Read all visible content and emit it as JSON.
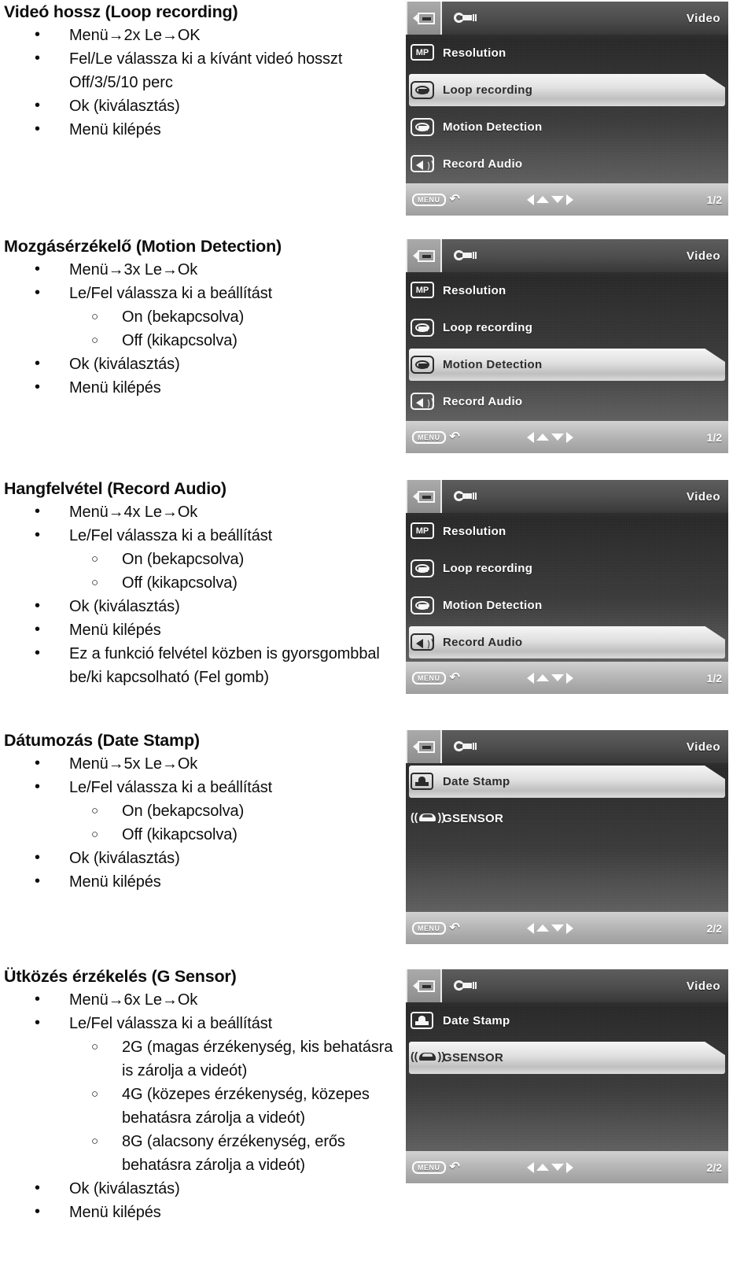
{
  "document": {
    "language": "hu",
    "sections": [
      {
        "id": "loop-recording",
        "heading": "Videó hossz (Loop recording)",
        "items": [
          {
            "level": 1,
            "text": "Menü→2x Le→OK"
          },
          {
            "level": 1,
            "text": "Fel/Le válassza ki a kívánt videó hosszt"
          },
          {
            "level": 0,
            "text": "Off/3/5/10 perc"
          },
          {
            "level": 1,
            "text": "Ok (kiválasztás)"
          },
          {
            "level": 1,
            "text": "Menü kilépés"
          }
        ]
      },
      {
        "id": "motion-detection",
        "heading": "Mozgásérzékelő (Motion Detection)",
        "items": [
          {
            "level": 1,
            "text": "Menü→3x Le→Ok"
          },
          {
            "level": 1,
            "text": "Le/Fel válassza ki a beállítást"
          },
          {
            "level": 2,
            "text": "On (bekapcsolva)"
          },
          {
            "level": 2,
            "text": "Off (kikapcsolva)"
          },
          {
            "level": 1,
            "text": "Ok (kiválasztás)"
          },
          {
            "level": 1,
            "text": "Menü kilépés"
          }
        ]
      },
      {
        "id": "record-audio",
        "heading": "Hangfelvétel (Record Audio)",
        "items": [
          {
            "level": 1,
            "text": "Menü→4x Le→Ok"
          },
          {
            "level": 1,
            "text": "Le/Fel válassza ki a beállítást"
          },
          {
            "level": 2,
            "text": "On (bekapcsolva)"
          },
          {
            "level": 2,
            "text": "Off (kikapcsolva)"
          },
          {
            "level": 1,
            "text": "Ok (kiválasztás)"
          },
          {
            "level": 1,
            "text": "Menü kilépés"
          },
          {
            "level": 1,
            "text": "Ez a funkció felvétel közben is gyorsgombbal be/ki kapcsolható (Fel gomb)"
          }
        ]
      },
      {
        "id": "date-stamp",
        "heading": "Dátumozás (Date Stamp)",
        "items": [
          {
            "level": 1,
            "text": "Menü→5x Le→Ok"
          },
          {
            "level": 1,
            "text": "Le/Fel válassza ki a beállítást"
          },
          {
            "level": 2,
            "text": "On (bekapcsolva)"
          },
          {
            "level": 2,
            "text": "Off (kikapcsolva)"
          },
          {
            "level": 1,
            "text": "Ok (kiválasztás)"
          },
          {
            "level": 1,
            "text": "Menü kilépés"
          }
        ]
      },
      {
        "id": "g-sensor",
        "heading": "Ütközés érzékelés (G Sensor)",
        "items": [
          {
            "level": 1,
            "text": "Menü→6x Le→Ok"
          },
          {
            "level": 1,
            "text": "Le/Fel válassza ki a beállítást"
          },
          {
            "level": 2,
            "text": "2G (magas érzékenység, kis behatásra is zárolja a videót)"
          },
          {
            "level": 2,
            "text": "4G (közepes érzékenység, közepes behatásra zárolja a videót)"
          },
          {
            "level": 2,
            "text": "8G (alacsony érzékenység, erős behatásra zárolja a videót)"
          },
          {
            "level": 1,
            "text": "Ok (kiválasztás)"
          },
          {
            "level": 1,
            "text": "Menü kilépés"
          }
        ]
      }
    ]
  },
  "screenshots": [
    {
      "id": "shot-loop-recording",
      "title": "Video",
      "tabs": [
        "video-camera-icon",
        "wrench-icon"
      ],
      "selected_tab": "video-camera-icon",
      "page_indicator": "1/2",
      "menu_button_label": "MENU",
      "rows": [
        {
          "icon": "mp-icon",
          "icon_text": "MP",
          "label": "Resolution",
          "selected": false
        },
        {
          "icon": "loop-icon",
          "icon_text": "",
          "label": "Loop recording",
          "selected": true
        },
        {
          "icon": "loop-icon",
          "icon_text": "",
          "label": "Motion Detection",
          "selected": false
        },
        {
          "icon": "audio-icon",
          "icon_text": "",
          "label": "Record Audio",
          "selected": false
        }
      ]
    },
    {
      "id": "shot-motion-detection",
      "title": "Video",
      "tabs": [
        "video-camera-icon",
        "wrench-icon"
      ],
      "selected_tab": "video-camera-icon",
      "page_indicator": "1/2",
      "menu_button_label": "MENU",
      "rows": [
        {
          "icon": "mp-icon",
          "icon_text": "MP",
          "label": "Resolution",
          "selected": false
        },
        {
          "icon": "loop-icon",
          "icon_text": "",
          "label": "Loop recording",
          "selected": false
        },
        {
          "icon": "loop-icon",
          "icon_text": "",
          "label": "Motion Detection",
          "selected": true
        },
        {
          "icon": "audio-icon",
          "icon_text": "",
          "label": "Record Audio",
          "selected": false
        }
      ]
    },
    {
      "id": "shot-record-audio",
      "title": "Video",
      "tabs": [
        "video-camera-icon",
        "wrench-icon"
      ],
      "selected_tab": "video-camera-icon",
      "page_indicator": "1/2",
      "menu_button_label": "MENU",
      "rows": [
        {
          "icon": "mp-icon",
          "icon_text": "MP",
          "label": "Resolution",
          "selected": false
        },
        {
          "icon": "loop-icon",
          "icon_text": "",
          "label": "Loop recording",
          "selected": false
        },
        {
          "icon": "loop-icon",
          "icon_text": "",
          "label": "Motion Detection",
          "selected": false
        },
        {
          "icon": "audio-icon",
          "icon_text": "",
          "label": "Record Audio",
          "selected": true
        }
      ]
    },
    {
      "id": "shot-date-stamp",
      "title": "Video",
      "tabs": [
        "video-camera-icon",
        "wrench-icon"
      ],
      "selected_tab": "video-camera-icon",
      "page_indicator": "2/2",
      "menu_button_label": "MENU",
      "rows": [
        {
          "icon": "stamp-icon",
          "icon_text": "",
          "label": "Date Stamp",
          "selected": true
        },
        {
          "icon": "gsensor-icon",
          "icon_text": "",
          "label": "GSENSOR",
          "selected": false
        }
      ]
    },
    {
      "id": "shot-gsensor",
      "title": "Video",
      "tabs": [
        "video-camera-icon",
        "wrench-icon"
      ],
      "selected_tab": "video-camera-icon",
      "page_indicator": "2/2",
      "menu_button_label": "MENU",
      "rows": [
        {
          "icon": "stamp-icon",
          "icon_text": "",
          "label": "Date Stamp",
          "selected": false
        },
        {
          "icon": "gsensor-icon",
          "icon_text": "",
          "label": "GSENSOR",
          "selected": true
        }
      ]
    }
  ],
  "colors": {
    "page_background": "#ffffff",
    "text": "#0d0d0d",
    "screen_background": "#3c3c3c",
    "highlight": "#e6e6e6"
  }
}
